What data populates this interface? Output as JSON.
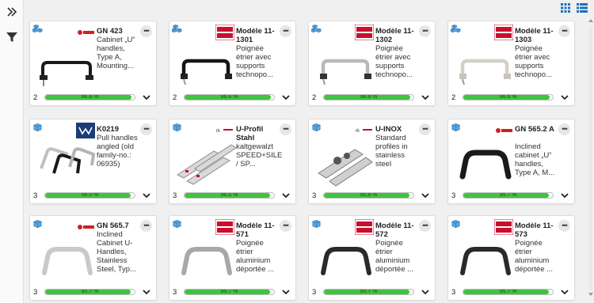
{
  "toolbar": {
    "expand_icon": "double-chevron-right-icon",
    "filter_icon": "filter-funnel-icon",
    "grid_view_icon": "grid-view-icon",
    "list_view_icon": "list-view-icon"
  },
  "colors": {
    "accent_blue": "#1e6fbd",
    "progress_green": "#3ec43e",
    "card_border": "#dcdcdc"
  },
  "cards": [
    {
      "icon": "multi-cube-icon",
      "logo": "ganter-logo",
      "title": "GN 423",
      "description": "Cabinet „U“ handles, Type A, Mounting...",
      "count": "2",
      "match": "96.6 %",
      "match_value": 96.6
    },
    {
      "icon": "multi-cube-icon",
      "logo": "elesa-logo",
      "title": "Modèle 11-1301",
      "description": "Poignée étrier avec supports technopo...",
      "count": "2",
      "match": "96.6 %",
      "match_value": 96.6
    },
    {
      "icon": "multi-cube-icon",
      "logo": "elesa-logo",
      "title": "Modèle 11-1302",
      "description": "Poignée étrier avec supports technopo...",
      "count": "2",
      "match": "96.6 %",
      "match_value": 96.6
    },
    {
      "icon": "multi-cube-icon",
      "logo": "elesa-logo",
      "title": "Modèle 11-1303",
      "description": "Poignée étrier avec supports technopo...",
      "count": "2",
      "match": "96.6 %",
      "match_value": 96.6
    },
    {
      "icon": "cube-icon",
      "logo": "wurth-logo",
      "title": "K0219",
      "description": "Pull handles angled (old family-no.: 06935)",
      "count": "3",
      "match": "96.0 %",
      "match_value": 96.0
    },
    {
      "icon": "cube-icon",
      "logo": "rk-logo",
      "title": "U-Profil Stahl",
      "description": "kaltgewalzt SPEED+SILENT / SP...",
      "count": "3",
      "match": "96.0 %",
      "match_value": 96.0
    },
    {
      "icon": "cube-icon",
      "logo": "rk-logo",
      "title": "U-INOX",
      "description": "Standard profiles in stainless steel",
      "count": "3",
      "match": "95.8 %",
      "match_value": 95.8
    },
    {
      "icon": "cube-icon",
      "logo": "ganter-logo",
      "title": "GN 565.2 A",
      "description": "Inclined cabinet „U“ handles, Type A, M...",
      "count": "3",
      "match": "95.7 %",
      "match_value": 95.7
    },
    {
      "icon": "cube-icon",
      "logo": "ganter-logo",
      "title": "GN 565.7",
      "description": "Inclined Cabinet U-Handles, Stainless Steel, Typ...",
      "count": "3",
      "match": "95.7 %",
      "match_value": 95.7
    },
    {
      "icon": "cube-icon",
      "logo": "elesa-logo",
      "title": "Modèle 11-571",
      "description": "Poignée étrier aluminium déportée ...",
      "count": "3",
      "match": "95.7 %",
      "match_value": 95.7
    },
    {
      "icon": "cube-icon",
      "logo": "elesa-logo",
      "title": "Modèle 11-572",
      "description": "Poignée étrier aluminium déportée ...",
      "count": "3",
      "match": "95.7 %",
      "match_value": 95.7
    },
    {
      "icon": "cube-icon",
      "logo": "elesa-logo",
      "title": "Modèle 11-573",
      "description": "Poignée étrier aluminium déportée ...",
      "count": "3",
      "match": "95.7 %",
      "match_value": 95.7
    }
  ],
  "more_label": "•••"
}
